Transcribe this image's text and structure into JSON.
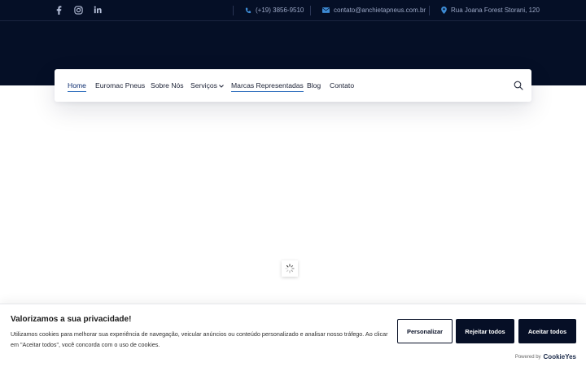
{
  "topbar": {
    "social": [
      "facebook-icon",
      "instagram-icon",
      "linkedin-icon"
    ],
    "phone": "(+19) 3856-9510",
    "email": "contato@anchietapneus.com.br",
    "address": "Rua Joana Forest Storani, 120"
  },
  "nav": {
    "items": [
      "Home",
      "Euromac Pneus",
      "Sobre Nós",
      "Serviços",
      "Marcas Representadas",
      "Blog",
      "Contato"
    ],
    "search_icon": "search-icon"
  },
  "cookie": {
    "title": "Valorizamos a sua privacidade!",
    "text": "Utilizamos cookies para melhorar sua experiência de navegação, veicular anúncios ou conteúdo personalizado e analisar nosso tráfego. Ao clicar em \"Aceitar todos\", você concorda com o uso de cookies.",
    "customize": "Personalizar",
    "reject": "Rejeitar todos",
    "accept": "Aceitar todos",
    "powered_by": "Powered by",
    "brand": "CookieYes"
  },
  "colors": {
    "hero": "#050f26",
    "accent": "#3d8bd4",
    "button_dark": "#060f26"
  }
}
